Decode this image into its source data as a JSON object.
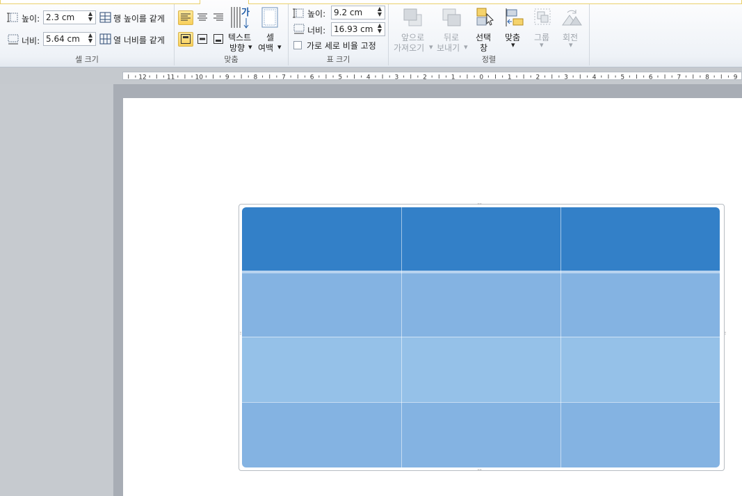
{
  "ribbon": {
    "cell_size": {
      "group_label": "셀 크기",
      "height_label": "높이:",
      "height_value": "2.3 cm",
      "width_label": "너비:",
      "width_value": "5.64 cm",
      "distribute_rows": "행 높이를 같게",
      "distribute_cols": "열 너비를 같게"
    },
    "alignment": {
      "group_label": "맞춤",
      "text_direction_1": "텍스트",
      "text_direction_2": "방향",
      "cell_margins_1": "셀",
      "cell_margins_2": "여백",
      "dropdown": "▾"
    },
    "table_size": {
      "group_label": "표 크기",
      "height_label": "높이:",
      "height_value": "9.2 cm",
      "width_label": "너비:",
      "width_value": "16.93 cm",
      "lock_aspect": "가로 세로 비율 고정"
    },
    "arrange": {
      "group_label": "정렬",
      "bring_forward_1": "앞으로",
      "bring_forward_2": "가져오기",
      "send_backward_1": "뒤로",
      "send_backward_2": "보내기",
      "selection_pane_1": "선택",
      "selection_pane_2": "창",
      "align": "맞춤",
      "group": "그룹",
      "rotate": "회전"
    }
  },
  "ruler": {
    "labels": [
      "12",
      "11",
      "10",
      "9",
      "8",
      "7",
      "6",
      "5",
      "4",
      "3",
      "2",
      "1",
      "0",
      "1",
      "2",
      "3",
      "4",
      "5",
      "6",
      "7",
      "8",
      "9"
    ]
  },
  "table": {
    "rows": 4,
    "cols": 3,
    "header_color": "#3380c8",
    "band_color_a": "#84b3e2",
    "band_color_b": "#95c1e8"
  }
}
